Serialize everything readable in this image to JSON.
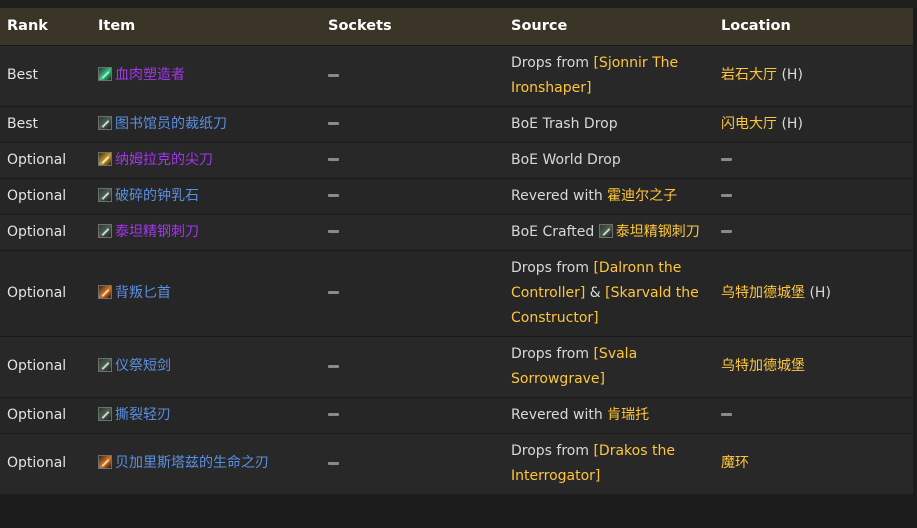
{
  "headers": {
    "rank": "Rank",
    "item": "Item",
    "sockets": "Sockets",
    "source": "Source",
    "location": "Location"
  },
  "rows": [
    {
      "rank": "Best",
      "item": "血肉塑造者",
      "source_prefix": "Drops from ",
      "source_link": "[Sjonnir The Ironshaper]",
      "location": "岩石大厅",
      "location_suffix": " (H)"
    },
    {
      "rank": "Best",
      "item": "图书馆员的裁纸刀",
      "source_text": "BoE Trash Drop",
      "location": "闪电大厅",
      "location_suffix": " (H)"
    },
    {
      "rank": "Optional",
      "item": "纳姆拉克的尖刀",
      "source_text": "BoE World Drop"
    },
    {
      "rank": "Optional",
      "item": "破碎的钟乳石",
      "source_prefix": "Revered with ",
      "source_link": "霍迪尔之子"
    },
    {
      "rank": "Optional",
      "item": "泰坦精钢刺刀",
      "source_prefix": "BoE Crafted ",
      "source_link": "泰坦精钢刺刀"
    },
    {
      "rank": "Optional",
      "item": "背叛匕首",
      "source_prefix": "Drops from ",
      "source_link": "[Dalronn the Controller]",
      "source_mid": " & ",
      "source_link2": "[Skarvald the Constructor]",
      "location": "乌特加德城堡",
      "location_suffix": " (H)"
    },
    {
      "rank": "Optional",
      "item": "仪祭短剑",
      "source_prefix": "Drops from ",
      "source_link": "[Svala Sorrowgrave]",
      "location": "乌特加德城堡"
    },
    {
      "rank": "Optional",
      "item": "撕裂轻刃",
      "source_prefix": "Revered with ",
      "source_link": "肯瑞托"
    },
    {
      "rank": "Optional",
      "item": "贝加里斯塔兹的生命之刃",
      "source_prefix": "Drops from ",
      "source_link": "[Drakos the Interrogator]",
      "location": "魔环"
    }
  ],
  "icons": {
    "item_icon": "dagger-icon",
    "empty_socket": "dash-icon"
  },
  "colors": {
    "epic_item": "#a335ee",
    "rare_item": "#5a8fe0",
    "link_gold": "#ffc63a",
    "header_bg": "#3a3527"
  }
}
